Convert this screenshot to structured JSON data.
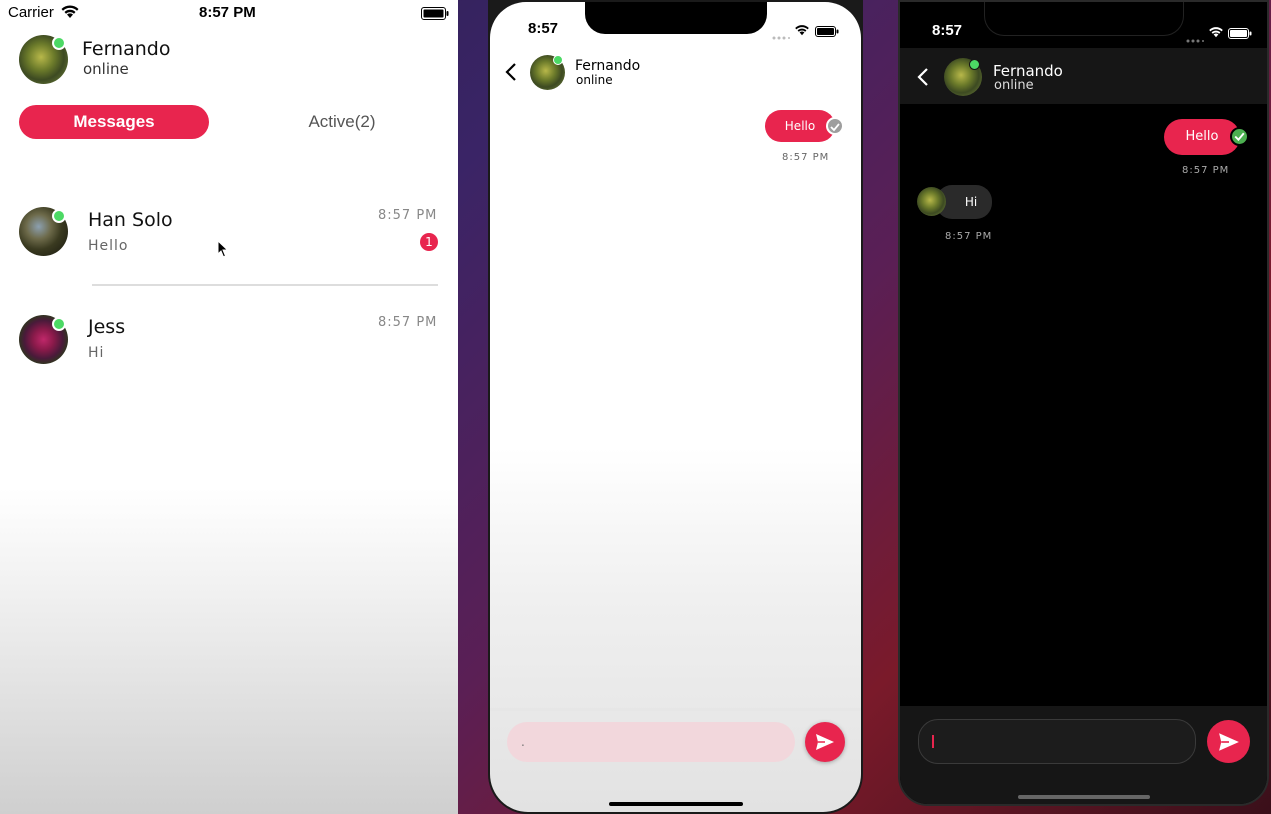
{
  "phone1": {
    "status_bar": {
      "carrier": "Carrier",
      "time": "8:57 PM"
    },
    "profile": {
      "name": "Fernando",
      "status": "online"
    },
    "tabs": {
      "messages": "Messages",
      "active": "Active(2)"
    },
    "conversations": [
      {
        "name": "Han Solo",
        "last_message": "Hello",
        "time": "8:57 PM",
        "unread": "1"
      },
      {
        "name": "Jess",
        "last_message": "Hi",
        "time": "8:57 PM"
      }
    ]
  },
  "phone2": {
    "status_bar": {
      "time": "8:57"
    },
    "header": {
      "name": "Fernando",
      "status": "online"
    },
    "messages": [
      {
        "text": "Hello",
        "time": "8:57 PM",
        "direction": "out"
      }
    ],
    "input": {
      "placeholder": "."
    }
  },
  "phone3": {
    "status_bar": {
      "time": "8:57"
    },
    "header": {
      "name": "Fernando",
      "status": "online"
    },
    "messages": [
      {
        "text": "Hello",
        "time": "8:57 PM",
        "direction": "out"
      },
      {
        "text": "Hi",
        "time": "8:57 PM",
        "direction": "in"
      }
    ],
    "input": {
      "placeholder": ""
    }
  },
  "colors": {
    "accent": "#e8254e",
    "online": "#4cd964",
    "read_check_light": "#9e9e9e",
    "read_check_dark": "#4caf50",
    "dark_bubble": "#2a2a2a"
  }
}
